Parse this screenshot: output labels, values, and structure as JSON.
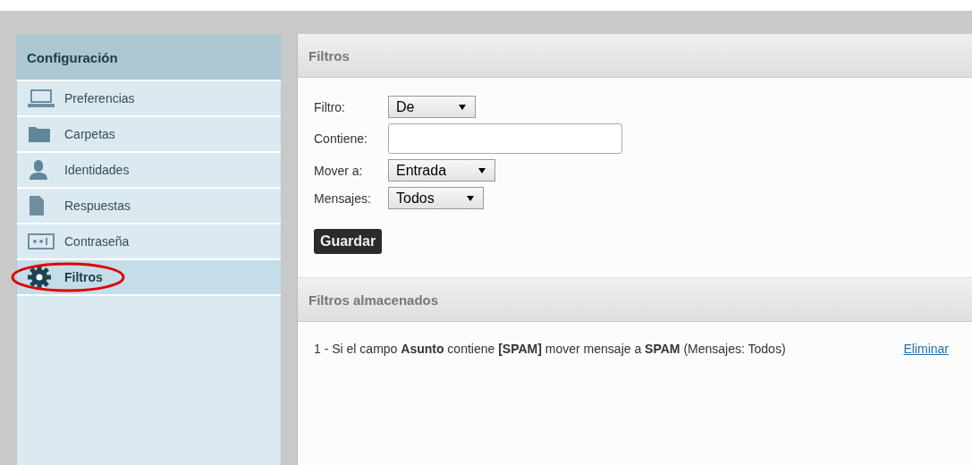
{
  "sidebar": {
    "title": "Configuración",
    "items": [
      {
        "label": "Preferencias",
        "kind": "laptop",
        "selected": false,
        "circled": false
      },
      {
        "label": "Carpetas",
        "kind": "folder",
        "selected": false,
        "circled": false
      },
      {
        "label": "Identidades",
        "kind": "person",
        "selected": false,
        "circled": false
      },
      {
        "label": "Respuestas",
        "kind": "document",
        "selected": false,
        "circled": false
      },
      {
        "label": "Contraseña",
        "kind": "password",
        "selected": false,
        "circled": false
      },
      {
        "label": "Filtros",
        "kind": "gear",
        "selected": true,
        "circled": true
      }
    ]
  },
  "filter_panel": {
    "title": "Filtros",
    "fields": [
      {
        "label": "Filtro:",
        "kind": "select",
        "value": "De"
      },
      {
        "label": "Contiene:",
        "kind": "text"
      },
      {
        "label": "Mover a:",
        "kind": "select",
        "value": "Entrada"
      },
      {
        "label": "Mensajes:",
        "kind": "select",
        "value": "Todos"
      }
    ],
    "button": "Guardar"
  },
  "stored_panel": {
    "title": "Filtros almacenados",
    "rules": [
      {
        "text": "1 - Si el campo **Asunto** contiene **[SPAM]** mover mensaje a **SPAM** (Mensajes: Todos)",
        "action": "Eliminar"
      }
    ]
  }
}
